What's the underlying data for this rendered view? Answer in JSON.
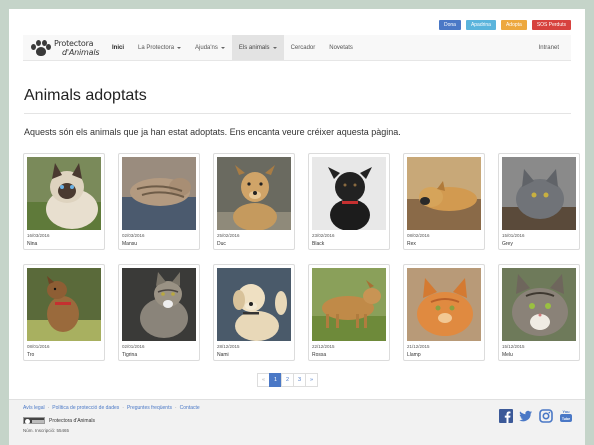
{
  "utility_buttons": [
    "Dona",
    "Apadrina",
    "Adopta",
    "SOS Perduts"
  ],
  "brand": {
    "line1": "Protectora",
    "line2": "d'Animals"
  },
  "nav": [
    {
      "label": "Inici",
      "dropdown": false
    },
    {
      "label": "La Protectora",
      "dropdown": true
    },
    {
      "label": "Ajuda'ns",
      "dropdown": true
    },
    {
      "label": "Els animals",
      "dropdown": true
    },
    {
      "label": "Cercador",
      "dropdown": false
    },
    {
      "label": "Novetats",
      "dropdown": false
    }
  ],
  "nav_right": "Intranet",
  "page": {
    "title": "Animals adoptats",
    "intro": "Aquests són els animals que ja han estat adoptats. Ens encanta veure créixer aquesta pàgina."
  },
  "animals": [
    {
      "date": "16/03/2016",
      "name": "Nina",
      "photo": "siamese-cat"
    },
    {
      "date": "02/03/2016",
      "name": "Mansu",
      "photo": "sleeping-tabby-cat"
    },
    {
      "date": "25/02/2016",
      "name": "Duc",
      "photo": "tan-dog"
    },
    {
      "date": "23/02/2016",
      "name": "Black",
      "photo": "black-dog"
    },
    {
      "date": "08/02/2016",
      "name": "Rex",
      "photo": "lying-dog"
    },
    {
      "date": "15/01/2016",
      "name": "Grey",
      "photo": "grey-cat"
    },
    {
      "date": "08/01/2016",
      "name": "Tro",
      "photo": "small-brown-dog"
    },
    {
      "date": "02/01/2016",
      "name": "Tigrina",
      "photo": "tabby-cat"
    },
    {
      "date": "28/12/2015",
      "name": "Nami",
      "photo": "labrador"
    },
    {
      "date": "22/12/2015",
      "name": "Rossa",
      "photo": "golden-dog"
    },
    {
      "date": "21/12/2015",
      "name": "Llamp",
      "photo": "orange-cat"
    },
    {
      "date": "15/12/2015",
      "name": "Melu",
      "photo": "tabby-white-cat"
    }
  ],
  "pagination": {
    "prev": "«",
    "pages": [
      "1",
      "2",
      "3"
    ],
    "current": "1",
    "next": "»"
  },
  "footer": {
    "links": [
      "Avís legal",
      "Política de protecció de dades",
      "Preguntes freqüents",
      "Contacte"
    ],
    "separator": "·",
    "org": "Protectora d'Animals",
    "registry": "Núm. Inscripció: 55465",
    "social": [
      "facebook-icon",
      "twitter-icon",
      "instagram-icon",
      "youtube-icon"
    ]
  },
  "colors": {
    "accent": "#4a78c6",
    "background": "#c5d4c9"
  }
}
